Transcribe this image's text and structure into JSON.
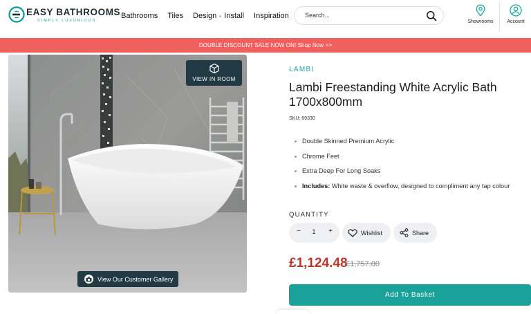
{
  "header": {
    "logo": {
      "name": "EASY BATHROOMS",
      "tagline": "SIMPLY LUXURIOUS"
    },
    "nav": [
      "Bathrooms",
      "Tiles",
      "Design",
      "Install",
      "Inspiration"
    ],
    "search": {
      "placeholder": "Search..."
    },
    "actions": {
      "showrooms": "Showrooms",
      "account": "Account"
    }
  },
  "banner": {
    "text": "DOUBLE DISCOUNT SALE NOW ON! Shop Now >>"
  },
  "gallery": {
    "view_in_room": "VIEW IN ROOM",
    "customer_gallery": "View Our Customer Gallery"
  },
  "product": {
    "brand": "LAMBI",
    "title": "Lambi Freestanding White Acrylic Bath 1700x800mm",
    "sku": "SKU: 69330",
    "features": [
      "Double Skinned Premium Acrylic",
      "Chrome Feet",
      "Extra Deep For Long Soaks"
    ],
    "includes_label": "Includes:",
    "includes_text": " White waste & overflow, designed to compliment any tap colour",
    "quantity_label": "QUANTITY",
    "quantity": "1",
    "minus": "−",
    "plus": "+",
    "wishlist": "Wishlist",
    "share": "Share",
    "price": "£1,124.48",
    "was_price": "£1,757.00",
    "add_to_basket": "Add To Basket"
  },
  "colors": {
    "accent": "#1aa199",
    "banner": "#f0605f",
    "price": "#b63a2c",
    "dark_overlay": "#213a44"
  }
}
